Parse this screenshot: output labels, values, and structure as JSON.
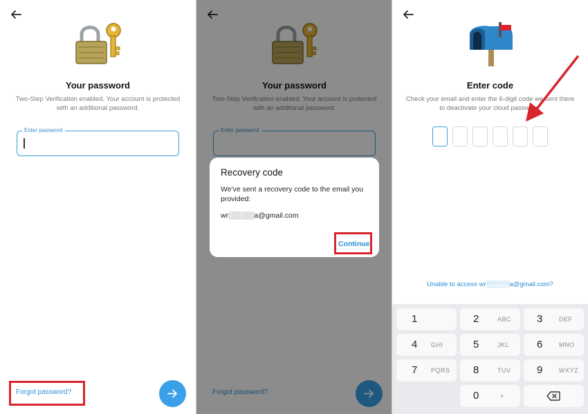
{
  "panel_password": {
    "title": "Your password",
    "subtitle": "Two-Step Verification enabled. Your account is protected with an additional password.",
    "input_label": "Enter password",
    "input_value": "",
    "forgot_label": "Forgot password?",
    "fab_icon": "arrow-right-icon"
  },
  "panel_dialog": {
    "title": "Your password",
    "subtitle": "Two-Step Verification enabled. Your account is protected with an additional password.",
    "input_label": "Enter password",
    "forgot_label": "Forgot password?",
    "dialog": {
      "title": "Recovery code",
      "body": "We've sent a recovery code to the email you provided:",
      "email": "wr░░░░░a@gmail.com",
      "continue_label": "Continue"
    }
  },
  "panel_code": {
    "title": "Enter code",
    "subtitle": "Check your email and enter the 6-digit code we sent there to deactivate your cloud password.",
    "code_digits": [
      "",
      "",
      "",
      "",
      "",
      ""
    ],
    "unable_link": "Unable to access wr░░░░░a@gmail.com?",
    "keypad": [
      {
        "num": "1",
        "letters": ""
      },
      {
        "num": "2",
        "letters": "ABC"
      },
      {
        "num": "3",
        "letters": "DEF"
      },
      {
        "num": "4",
        "letters": "GHI"
      },
      {
        "num": "5",
        "letters": "JKL"
      },
      {
        "num": "6",
        "letters": "MNO"
      },
      {
        "num": "7",
        "letters": "PQRS"
      },
      {
        "num": "8",
        "letters": "TUV"
      },
      {
        "num": "9",
        "letters": "WXYZ"
      },
      {
        "num": "0",
        "letters": "+"
      }
    ],
    "backspace_icon": "backspace-icon"
  },
  "colors": {
    "accent": "#3aa0e8",
    "link": "#2b8fd6",
    "highlight_box": "#d9242c",
    "annotation_arrow": "#d9242c"
  },
  "icons": [
    "back-arrow-icon",
    "padlock-with-key-icon",
    "mailbox-icon",
    "arrow-right-icon",
    "backspace-icon"
  ]
}
